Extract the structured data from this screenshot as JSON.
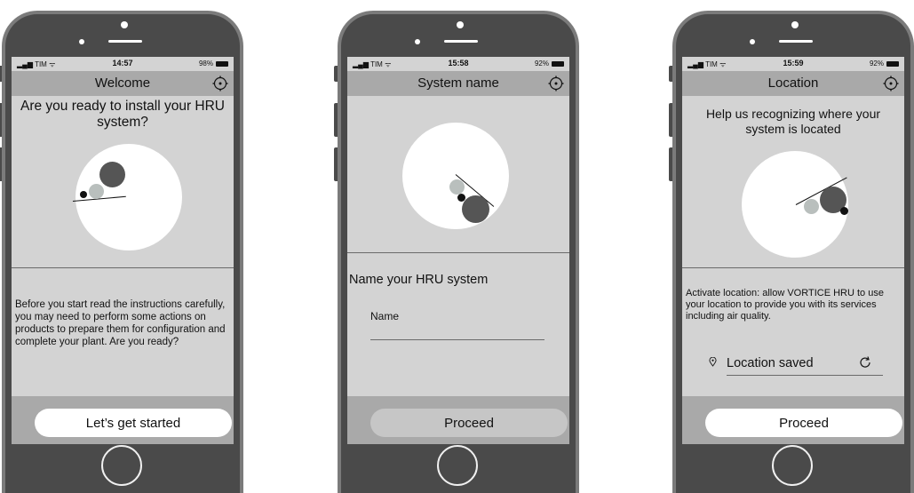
{
  "phones": [
    {
      "status": {
        "carrier": "TIM",
        "time": "14:57",
        "battery": "98%"
      },
      "nav": {
        "title": "Welcome"
      },
      "heading": "Are you ready to install your HRU system?",
      "body": "Before you start read the instructions carefully, you may need to perform some actions on products to prepare them for configuration and complete your plant. Are you ready?",
      "button": "Let’s get started"
    },
    {
      "status": {
        "carrier": "TIM",
        "time": "15:58",
        "battery": "92%"
      },
      "nav": {
        "title": "System name"
      },
      "section_title": "Name your HRU system",
      "field_label": "Name",
      "button": "Proceed"
    },
    {
      "status": {
        "carrier": "TIM",
        "time": "15:59",
        "battery": "92%"
      },
      "nav": {
        "title": "Location"
      },
      "heading": "Help us recognizing where your system is located",
      "body": "Activate location: allow VORTICE HRU to use your location to provide you with its services including air quality.",
      "location_value": "Location saved",
      "button": "Proceed"
    }
  ],
  "colors": {
    "screen_bg": "#d3d3d3",
    "bar_bg": "#a9a9a9",
    "phone_body": "#4a4a4a",
    "ball_dark": "#555555",
    "ball_light": "#b9bfbd"
  }
}
